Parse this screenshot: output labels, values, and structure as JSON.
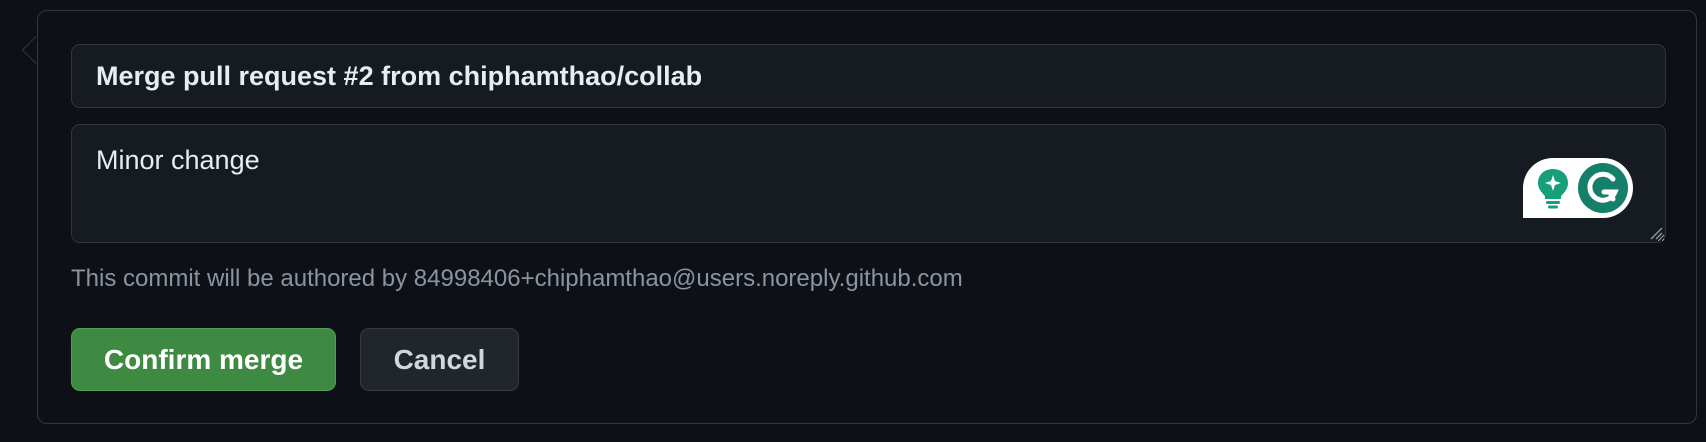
{
  "merge_form": {
    "commit_title": "Merge pull request #2 from chiphamthao/collab",
    "commit_body": "Minor change",
    "author_note": "This commit will be authored by 84998406+chiphamthao@users.noreply.github.com",
    "confirm_label": "Confirm merge",
    "cancel_label": "Cancel"
  },
  "icons": {
    "grammarly_assistant": "lightbulb-sparkle-icon",
    "grammarly_logo": "grammarly-g-icon",
    "resize": "resize-grip-icon"
  },
  "colors": {
    "background": "#0d1117",
    "field_background": "#161b22",
    "border": "#30363d",
    "confirm_button": "#3f8a43",
    "cancel_button": "#21262d",
    "muted_text": "#8b949e",
    "grammarly_green": "#15a07a"
  }
}
